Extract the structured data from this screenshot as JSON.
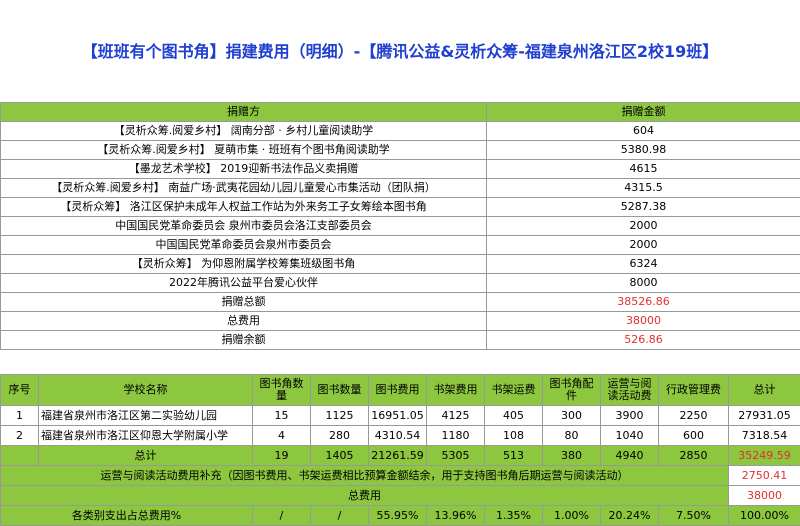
{
  "title": "【班班有个图书角】捐建费用（明细）-【腾讯公益&灵析众筹-福建泉州洛江区2校19班】",
  "donations": {
    "header": [
      "捐赠方",
      "捐赠金额"
    ],
    "rows": [
      [
        "【灵析众筹.阅爱乡村】 阔南分部 · 乡村儿童阅读助学",
        "604"
      ],
      [
        "【灵析众筹.阅爱乡村】 夏萌市集 · 班班有个图书角阅读助学",
        "5380.98"
      ],
      [
        "【墨龙艺术学校】 2019迎新书法作品义卖捐赠",
        "4615"
      ],
      [
        "【灵析众筹.阅爱乡村】 南益广场·武夷花园幼儿园儿童爱心市集活动（团队捐）",
        "4315.5"
      ],
      [
        "【灵析众筹】 洛江区保护未成年人权益工作站为外来务工子女筹绘本图书角",
        "5287.38"
      ],
      [
        "中国国民党革命委员会 泉州市委员会洛江支部委员会",
        "2000"
      ],
      [
        "中国国民党革命委员会泉州市委员会",
        "2000"
      ],
      [
        "【灵析众筹】 为仰恩附属学校筹集班级图书角",
        "6324"
      ],
      [
        "2022年腾讯公益平台爱心伙伴",
        "8000"
      ]
    ],
    "totals": [
      [
        "捐赠总额",
        "38526.86"
      ],
      [
        "总费用",
        "38000"
      ],
      [
        "捐赠余额",
        "526.86"
      ]
    ]
  },
  "expenses": {
    "header": [
      "序号",
      "学校名称",
      "图书角数量",
      "图书数量",
      "图书费用",
      "书架费用",
      "书架运费",
      "图书角配件",
      "运营与阅读活动费",
      "行政管理费",
      "总计"
    ],
    "rows": [
      [
        "1",
        "福建省泉州市洛江区第二实验幼儿园",
        "15",
        "1125",
        "16951.05",
        "4125",
        "405",
        "300",
        "3900",
        "2250",
        "27931.05"
      ],
      [
        "2",
        "福建省泉州市洛江区仰恩大学附属小学",
        "4",
        "280",
        "4310.54",
        "1180",
        "108",
        "80",
        "1040",
        "600",
        "7318.54"
      ]
    ],
    "sum_row": [
      "总计",
      "19",
      "1405",
      "21261.59",
      "5305",
      "513",
      "380",
      "4940",
      "2850",
      "35249.59"
    ],
    "supplement_label": "运营与阅读活动费用补充（因图书费用、书架运费相比预算金额结余，用于支持图书角后期运营与阅读活动）",
    "supplement_value": "2750.41",
    "total_label": "总费用",
    "total_value": "38000",
    "pct_label": "各类别支出占总费用%",
    "pct_values": [
      "/",
      "/",
      "55.95%",
      "13.96%",
      "1.35%",
      "1.00%",
      "20.24%",
      "7.50%",
      "100.00%"
    ]
  }
}
